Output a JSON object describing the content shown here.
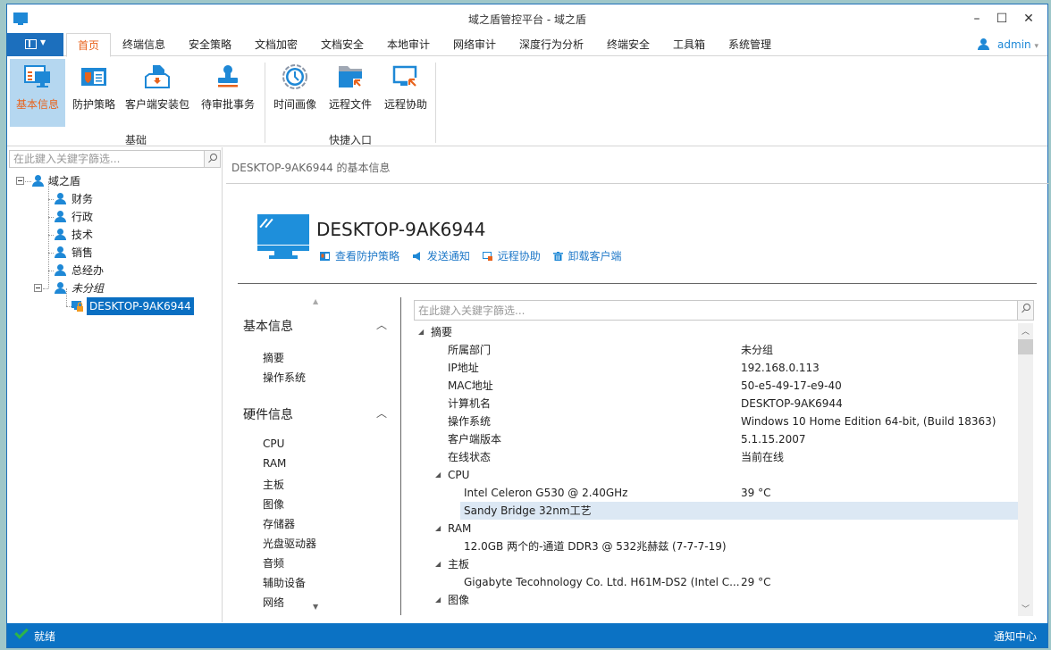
{
  "window": {
    "title": "域之盾管控平台 - 域之盾",
    "controls": {
      "minimize": "–",
      "maximize": "☐",
      "close": "✕"
    }
  },
  "menubar": {
    "tabs": [
      {
        "label": "首页",
        "active": true
      },
      {
        "label": "终端信息"
      },
      {
        "label": "安全策略"
      },
      {
        "label": "文档加密"
      },
      {
        "label": "文档安全"
      },
      {
        "label": "本地审计"
      },
      {
        "label": "网络审计"
      },
      {
        "label": "深度行为分析"
      },
      {
        "label": "终端安全"
      },
      {
        "label": "工具箱"
      },
      {
        "label": "系统管理"
      }
    ],
    "user": "admin",
    "user_caret": "▾"
  },
  "ribbon": {
    "groups": [
      {
        "label": "基础",
        "buttons": [
          {
            "label": "基本信息",
            "icon": "basic-info-icon",
            "active": true
          },
          {
            "label": "防护策略",
            "icon": "protection-policy-icon"
          },
          {
            "label": "客户端安装包",
            "icon": "client-package-icon"
          },
          {
            "label": "待审批事务",
            "icon": "approval-stamp-icon"
          }
        ]
      },
      {
        "label": "快捷入口",
        "buttons": [
          {
            "label": "时间画像",
            "icon": "clock-icon"
          },
          {
            "label": "远程文件",
            "icon": "remote-file-icon"
          },
          {
            "label": "远程协助",
            "icon": "remote-assist-icon"
          }
        ]
      }
    ]
  },
  "left_pane": {
    "search_placeholder": "在此鍵入关鍵字篩选...",
    "tree": {
      "root": "域之盾",
      "groups": [
        "财务",
        "行政",
        "技术",
        "销售",
        "总经办"
      ],
      "ungrouped": "未分组",
      "device": "DESKTOP-9AK6944"
    }
  },
  "right_pane": {
    "breadcrumb": "DESKTOP-9AK6944 的基本信息",
    "hostname": "DESKTOP-9AK6944",
    "actions": [
      {
        "label": "查看防护策略",
        "icon": "policy-icon"
      },
      {
        "label": "发送通知",
        "icon": "megaphone-icon"
      },
      {
        "label": "远程协助",
        "icon": "remote-assist-icon"
      },
      {
        "label": "卸载客户端",
        "icon": "trash-icon"
      }
    ],
    "nav": {
      "sections": [
        {
          "title": "基本信息",
          "items": [
            "摘要",
            "操作系统"
          ]
        },
        {
          "title": "硬件信息",
          "items": [
            "CPU",
            "RAM",
            "主板",
            "图像",
            "存储器",
            "光盘驱动器",
            "音频",
            "辅助设备",
            "网络"
          ]
        }
      ]
    },
    "filter_placeholder": "在此鍵入关鍵字篩选...",
    "details": [
      {
        "type": "group",
        "label": "摘要"
      },
      {
        "type": "row",
        "key": "所属部门",
        "value": "未分组"
      },
      {
        "type": "row",
        "key": "IP地址",
        "value": "192.168.0.113"
      },
      {
        "type": "row",
        "key": "MAC地址",
        "value": "50-e5-49-17-e9-40"
      },
      {
        "type": "row",
        "key": "计算机名",
        "value": "DESKTOP-9AK6944"
      },
      {
        "type": "row",
        "key": "操作系统",
        "value": "Windows 10 Home Edition 64-bit, (Build 18363)"
      },
      {
        "type": "row",
        "key": "客户端版本",
        "value": "5.1.15.2007"
      },
      {
        "type": "row",
        "key": "在线状态",
        "value": "当前在线"
      },
      {
        "type": "group",
        "label": "CPU"
      },
      {
        "type": "sub",
        "key": "Intel Celeron G530 @ 2.40GHz",
        "value": "39 °C"
      },
      {
        "type": "sub",
        "key": "Sandy Bridge 32nm工艺",
        "value": "",
        "selected": true
      },
      {
        "type": "group",
        "label": "RAM"
      },
      {
        "type": "sub",
        "key": "12.0GB 两个的-通道 DDR3 @ 532兆赫兹 (7-7-7-19)",
        "value": ""
      },
      {
        "type": "group",
        "label": "主板"
      },
      {
        "type": "sub",
        "key": "Gigabyte Tecohnology Co. Ltd. H61M-DS2 (Intel C...",
        "value": "29 °C"
      },
      {
        "type": "group",
        "label": "图像"
      }
    ]
  },
  "statusbar": {
    "status": "就绪",
    "notification_center": "通知中心"
  },
  "colors": {
    "accent": "#1e88d6",
    "active_tab": "#e8631c",
    "statusbar": "#0b72c4",
    "selection": "#0a6fc2",
    "ribbon_active": "#b5d7f0"
  }
}
